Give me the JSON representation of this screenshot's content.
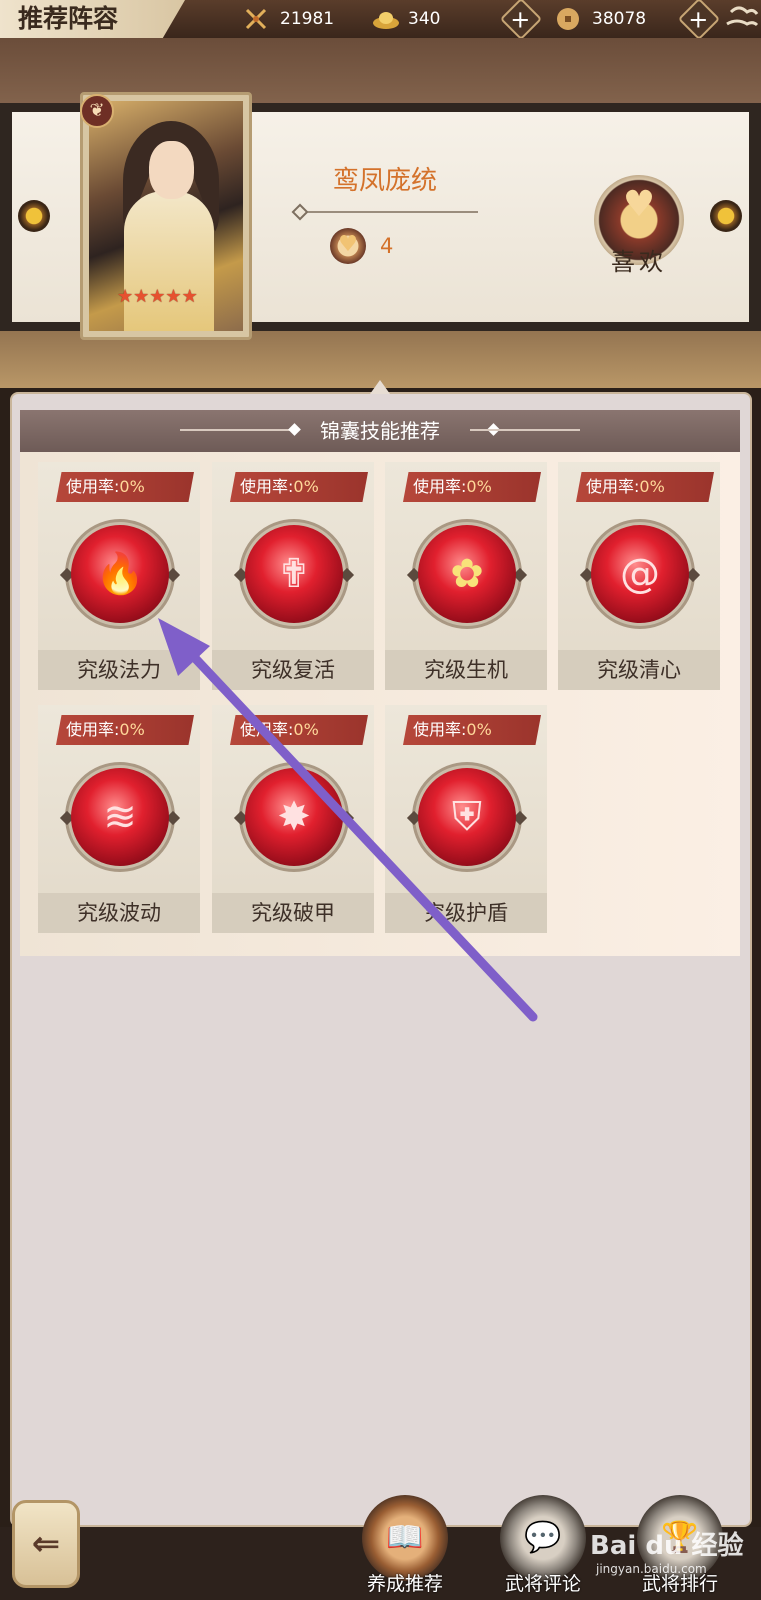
{
  "header": {
    "title": "推荐阵容",
    "stamina_value": "21981",
    "gold_ingot_value": "340",
    "copper_coin_value": "38078"
  },
  "hero": {
    "name": "鸾凤庞统",
    "star_count": 5,
    "like_count": "4",
    "like_label": "喜欢",
    "element_icon": "leaf-icon"
  },
  "section": {
    "title": "锦囊技能推荐",
    "rate_label": "使用率:",
    "skills": [
      {
        "name": "究级法力",
        "rate": "0%",
        "icon": "flame-icon"
      },
      {
        "name": "究级复活",
        "rate": "0%",
        "icon": "winged-cross-icon"
      },
      {
        "name": "究级生机",
        "rate": "0%",
        "icon": "flower-icon"
      },
      {
        "name": "究级清心",
        "rate": "0%",
        "icon": "swirl-icon"
      },
      {
        "name": "究级波动",
        "rate": "0%",
        "icon": "wave-icon"
      },
      {
        "name": "究级破甲",
        "rate": "0%",
        "icon": "shatter-icon"
      },
      {
        "name": "究级护盾",
        "rate": "0%",
        "icon": "shield-icon"
      }
    ]
  },
  "nav": {
    "back_icon": "back-arrow-icon",
    "items": [
      {
        "label": "养成推荐",
        "icon": "book-icon"
      },
      {
        "label": "武将评论",
        "icon": "chat-bubble-icon"
      },
      {
        "label": "武将排行",
        "icon": "trophy-icon"
      }
    ]
  },
  "watermark": {
    "brand": "Bai du 经验",
    "url": "jingyan.baidu.com"
  },
  "colors": {
    "accent_orange": "#d4722b",
    "rate_tag_red": "#b6473a",
    "orb_red": "#e1202e",
    "annotation_arrow": "#7f5fc9"
  }
}
